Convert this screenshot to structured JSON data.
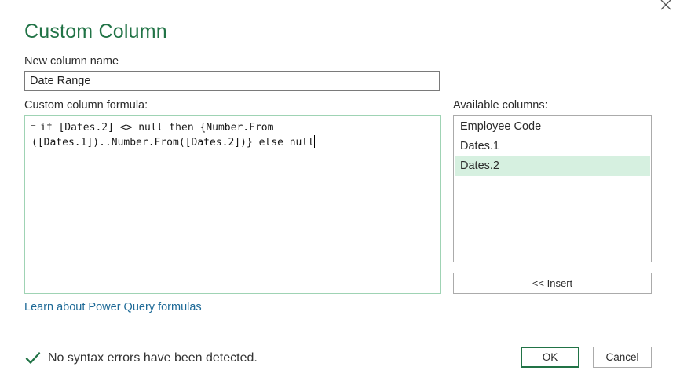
{
  "dialog": {
    "title": "Custom Column"
  },
  "new_column": {
    "label": "New column name",
    "value": "Date Range"
  },
  "formula": {
    "label": "Custom column formula:",
    "equals_sign": "=",
    "line1": "if [Dates.2] <> null then {Number.From",
    "line2": "([Dates.1])..Number.From([Dates.2])} else null"
  },
  "available_columns": {
    "label": "Available columns:",
    "items": [
      {
        "label": "Employee Code",
        "selected": false
      },
      {
        "label": "Dates.1",
        "selected": false
      },
      {
        "label": "Dates.2",
        "selected": true
      }
    ],
    "insert_label": "<< Insert"
  },
  "learn_link": "Learn about Power Query formulas",
  "status": {
    "icon": "check-icon",
    "text": "No syntax errors have been detected."
  },
  "buttons": {
    "ok": "OK",
    "cancel": "Cancel"
  },
  "colors": {
    "accent": "#217346",
    "selection": "#d6f0e0",
    "link": "#1e6a97"
  }
}
